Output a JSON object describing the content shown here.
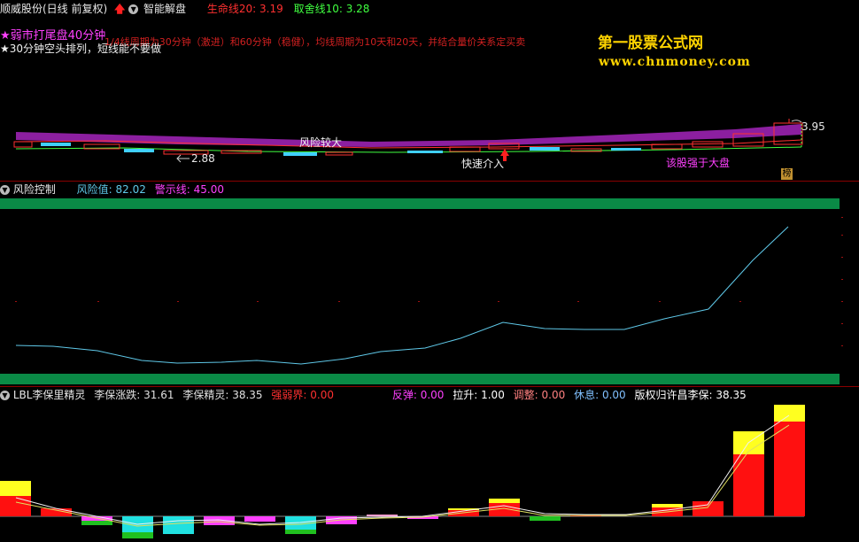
{
  "panel1": {
    "title": "顺威股份(日线 前复权)",
    "indicator_name": "智能解盘",
    "lifeline_label": "生命线20:",
    "lifeline_value": "3.19",
    "tradeline_label": "取舍线10:",
    "tradeline_value": "3.28",
    "note_weak": "★弱市打尾盘40分钟",
    "note_period": "1/4线周期为30分钟（激进）和60分钟（稳健），均线周期为10天和20天，并结合量价关系定买卖",
    "note_30min": "★30分钟空头排列，短线能不要做",
    "watermark_title": "第一股票公式网",
    "watermark_url": "www.chnmoney.com",
    "label_risk_high": "风险较大",
    "label_low": "2.88",
    "label_quick_entry": "快速介入",
    "label_stronger": "该股强于大盘",
    "label_high": "3.95",
    "badge_rank": "榜",
    "colors": {
      "lifeline": "#ff3030",
      "tradeline": "#40ff40",
      "purple_band": "#8c1fa0",
      "arrow_up": "#ff2020"
    }
  },
  "panel2": {
    "title": "风险控制",
    "risk_label": "风险值:",
    "risk_value": "82.02",
    "warn_label": "警示线:",
    "warn_value": "45.00",
    "colors": {
      "band": "#0a8a46",
      "line": "#5fc8e8"
    }
  },
  "panel3": {
    "title": "LBL李保里精灵",
    "items": [
      {
        "label": "李保涨跌:",
        "value": "31.61",
        "color": "#e0e0e0"
      },
      {
        "label": "李保精灵:",
        "value": "38.35",
        "color": "#e0e0e0"
      },
      {
        "label": "强弱界:",
        "value": "0.00",
        "color": "#ff3030"
      },
      {
        "label": "反弹:",
        "value": "0.00",
        "color": "#ff40ff"
      },
      {
        "label": "拉升:",
        "value": "1.00",
        "color": "#ffffff"
      },
      {
        "label": "调整:",
        "value": "0.00",
        "color": "#ff8080"
      },
      {
        "label": "休息:",
        "value": "0.00",
        "color": "#80c0ff"
      },
      {
        "label": "版权归许昌李保:",
        "value": "38.35",
        "color": "#ffffff"
      }
    ]
  }
}
